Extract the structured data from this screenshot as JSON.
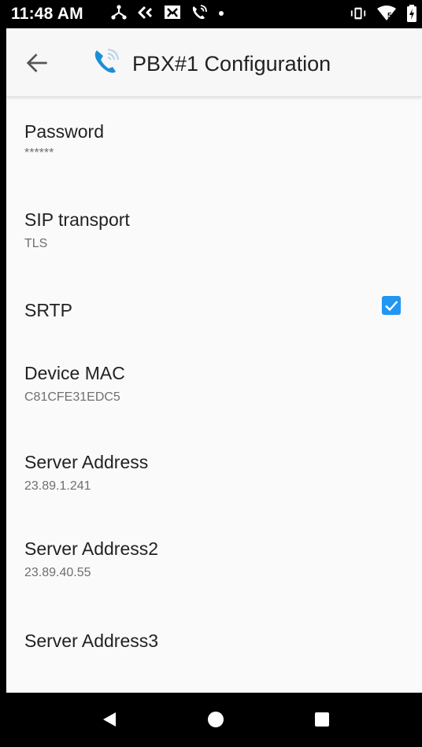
{
  "status_bar": {
    "time": "11:48 AM",
    "left_icons": [
      "share-tree-icon",
      "reply-arrows-icon",
      "message-box-icon",
      "phone-wifi-icon",
      "dot-icon"
    ],
    "right_icons": [
      "vibrate-icon",
      "wifi-icon",
      "battery-charging-icon"
    ],
    "wifi_label": "5"
  },
  "app_bar": {
    "back_icon": "arrow-left-icon",
    "app_icon": "phone-wifi-call-icon",
    "title": "PBX#1 Configuration"
  },
  "preferences": [
    {
      "title": "Password",
      "summary": "******"
    },
    {
      "title": "SIP transport",
      "summary": "TLS"
    },
    {
      "title": "SRTP",
      "checked": true
    },
    {
      "title": "Device MAC",
      "summary": "C81CFE31EDC5"
    },
    {
      "title": "Server Address",
      "summary": "23.89.1.241"
    },
    {
      "title": "Server Address2",
      "summary": "23.89.40.55"
    },
    {
      "title": "Server Address3",
      "summary": ""
    }
  ],
  "nav_bar": {
    "back": "triangle-back-icon",
    "home": "circle-home-icon",
    "recents": "square-recents-icon"
  },
  "colors": {
    "accent": "#2196f3",
    "background": "#fafafa",
    "status_bar": "#000000"
  }
}
